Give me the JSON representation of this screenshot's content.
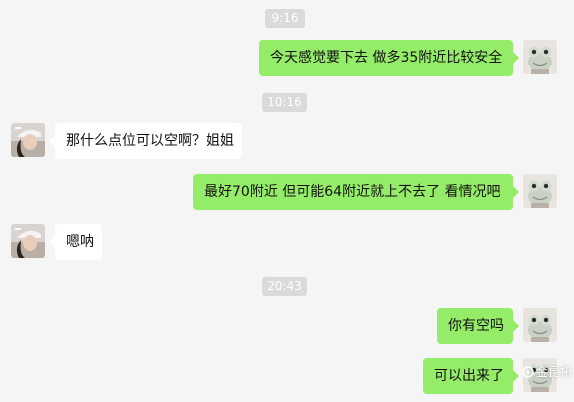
{
  "messages": [
    {
      "type": "time",
      "text": "9:16"
    },
    {
      "type": "out",
      "text": "今天感觉要下去  做多35附近比较安全",
      "avatar": "frog-avatar"
    },
    {
      "type": "time",
      "text": "10:16"
    },
    {
      "type": "in",
      "text": "那什么点位可以空啊？姐姐",
      "avatar": "girl-avatar"
    },
    {
      "type": "out",
      "text": "最好70附近  但可能64附近就上不去了  看情况吧",
      "avatar": "frog-avatar"
    },
    {
      "type": "in",
      "text": "嗯呐",
      "avatar": "girl-avatar"
    },
    {
      "type": "time",
      "text": "20:43"
    },
    {
      "type": "out",
      "text": "你有空吗",
      "avatar": "frog-avatar"
    },
    {
      "type": "out",
      "text": "可以出来了",
      "avatar": "frog-avatar"
    }
  ],
  "watermark": {
    "text": "金昆拓",
    "icon": "weibo-style-icon"
  },
  "colors": {
    "background": "#f5f5f5",
    "outgoing_bubble": "#95ec69",
    "incoming_bubble": "#ffffff",
    "timestamp_bg": "#dadada"
  }
}
